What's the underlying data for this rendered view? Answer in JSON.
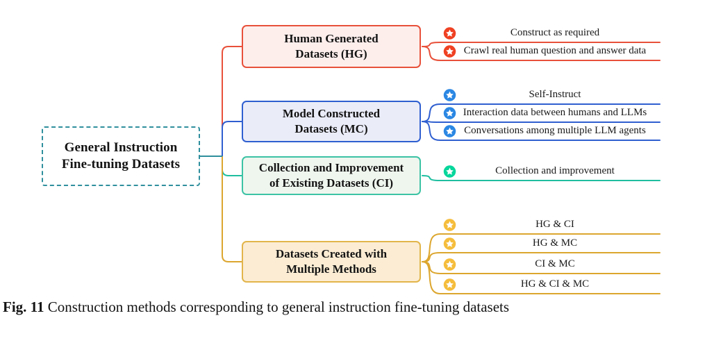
{
  "figure": {
    "root": {
      "line1": "General Instruction",
      "line2": "Fine-tuning Datasets",
      "color": "#2f8f9d"
    },
    "branches": [
      {
        "id": "human-generated",
        "title_line1": "Human Generated",
        "title_line2": "Datasets (HG)",
        "color": "#e8503a",
        "border": "#e8503a",
        "fill": "#fdeeec",
        "badge_color": "#ef4123",
        "leaves": [
          {
            "label": "Construct as required"
          },
          {
            "label": "Crawl real human question and answer data"
          }
        ]
      },
      {
        "id": "model-constructed",
        "title_line1": "Model Constructed",
        "title_line2": "Datasets (MC)",
        "color": "#2f5fd0",
        "border": "#2f5fd0",
        "fill": "#eaecf8",
        "badge_color": "#2b87e3",
        "leaves": [
          {
            "label": "Self-Instruct"
          },
          {
            "label": "Interaction data between humans and LLMs"
          },
          {
            "label": "Conversations among multiple LLM agents"
          }
        ]
      },
      {
        "id": "collection-improvement",
        "title_line1": "Collection and Improvement",
        "title_line2": "of Existing Datasets (CI)",
        "color": "#1fbfa0",
        "border": "#3cc3a5",
        "fill": "#eff6ee",
        "badge_color": "#07d69b",
        "leaves": [
          {
            "label": "Collection and improvement"
          }
        ]
      },
      {
        "id": "multiple-methods",
        "title_line1": "Datasets Created with",
        "title_line2": "Multiple Methods",
        "color": "#dca62e",
        "border": "#e2b54a",
        "fill": "#fbecd3",
        "badge_color": "#f5bd3c",
        "leaves": [
          {
            "label": "HG & CI"
          },
          {
            "label": "HG & MC"
          },
          {
            "label": "CI & MC"
          },
          {
            "label": "HG & CI & MC"
          }
        ]
      }
    ]
  },
  "caption": {
    "figure_number": "Fig. 11",
    "text": "Construction methods corresponding to general instruction fine-tuning datasets"
  }
}
